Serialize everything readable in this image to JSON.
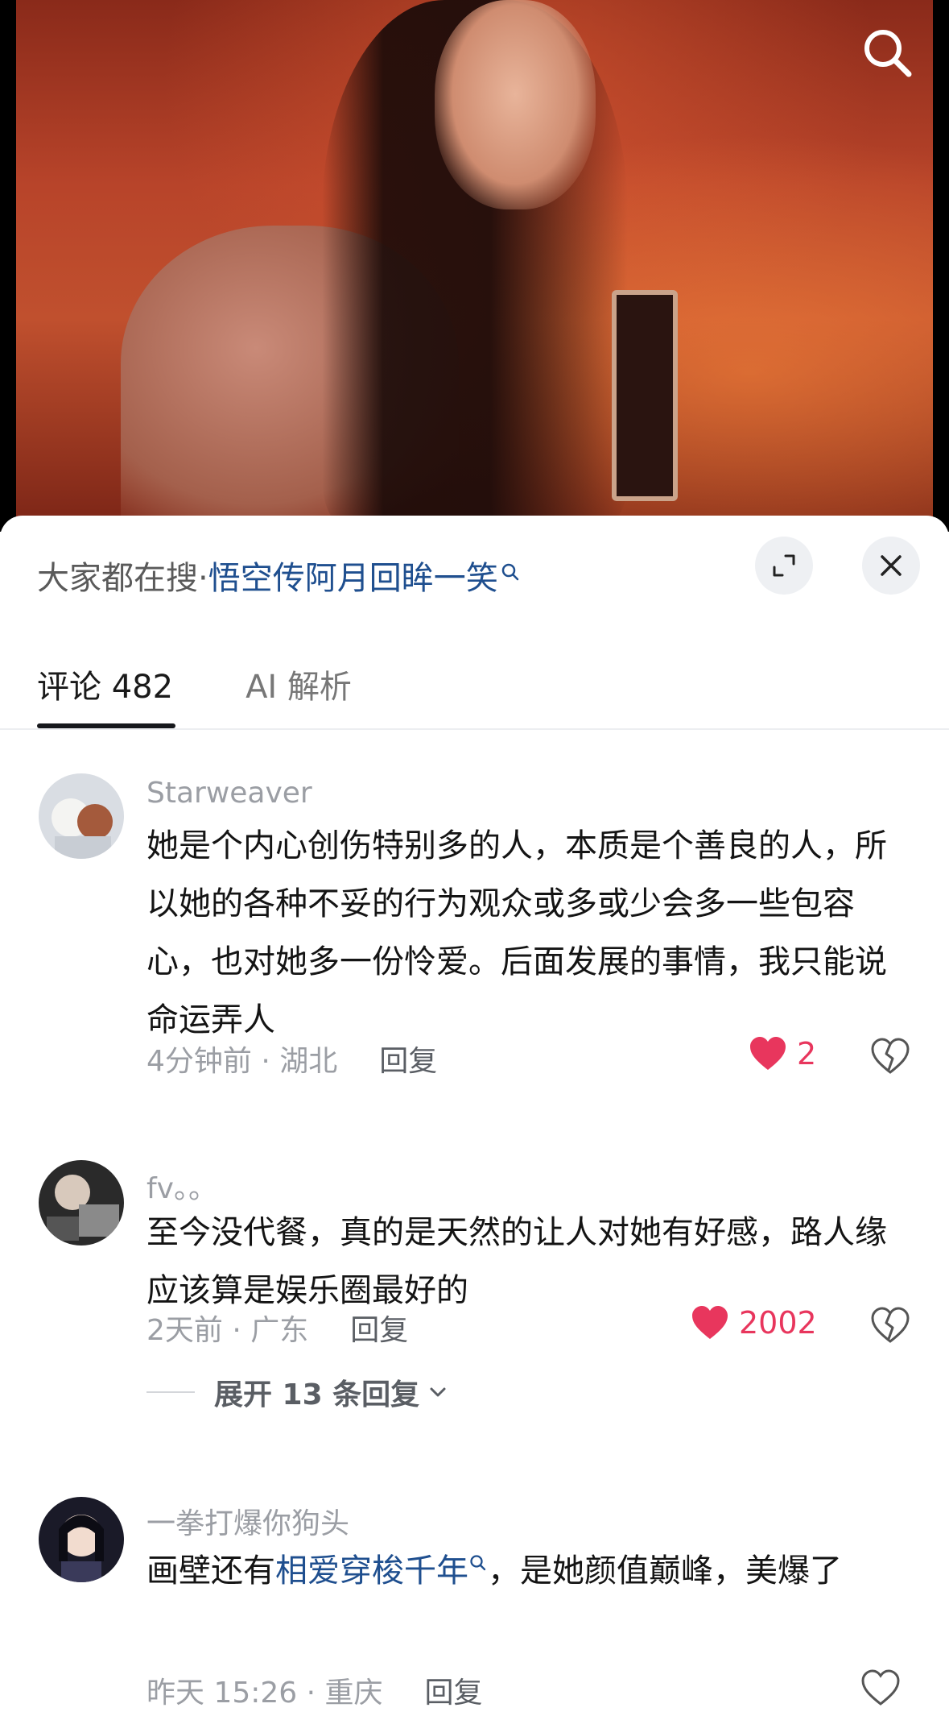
{
  "video": {
    "search_icon": "search-icon"
  },
  "hot_search": {
    "prefix": "大家都在搜·",
    "link": "悟空传阿月回眸一笑",
    "link_icon": "search-icon",
    "expand_icon": "expand-icon",
    "close_icon": "close-icon"
  },
  "tabs": [
    {
      "label": "评论 482",
      "active": true
    },
    {
      "label": "AI 解析",
      "active": false
    }
  ],
  "comments": [
    {
      "user": "Starweaver",
      "text": "她是个内心创伤特别多的人，本质是个善良的人，所以她的各种不妥的行为观众或多或少会多一些包容心，也对她多一份怜爱。后面发展的事情，我只能说命运弄人",
      "time_location": "4分钟前 · 湖北",
      "reply": "回复",
      "likes": "2"
    },
    {
      "user": "fv。。",
      "text": "至今没代餐，真的是天然的让人对她有好感，路人缘应该算是娱乐圈最好的",
      "time_location": "2天前 · 广东",
      "reply": "回复",
      "likes": "2002",
      "expand_replies": "展开 13 条回复"
    },
    {
      "user": "一拳打爆你狗头",
      "text_before": "画壁还有",
      "text_link": "相爱穿梭千年",
      "text_after": "，是她颜值巅峰，美爆了",
      "time_location": "昨天 15:26 · 重庆",
      "reply": "回复"
    }
  ],
  "colors": {
    "like": "#e8365d",
    "link": "#1f4f8f"
  }
}
